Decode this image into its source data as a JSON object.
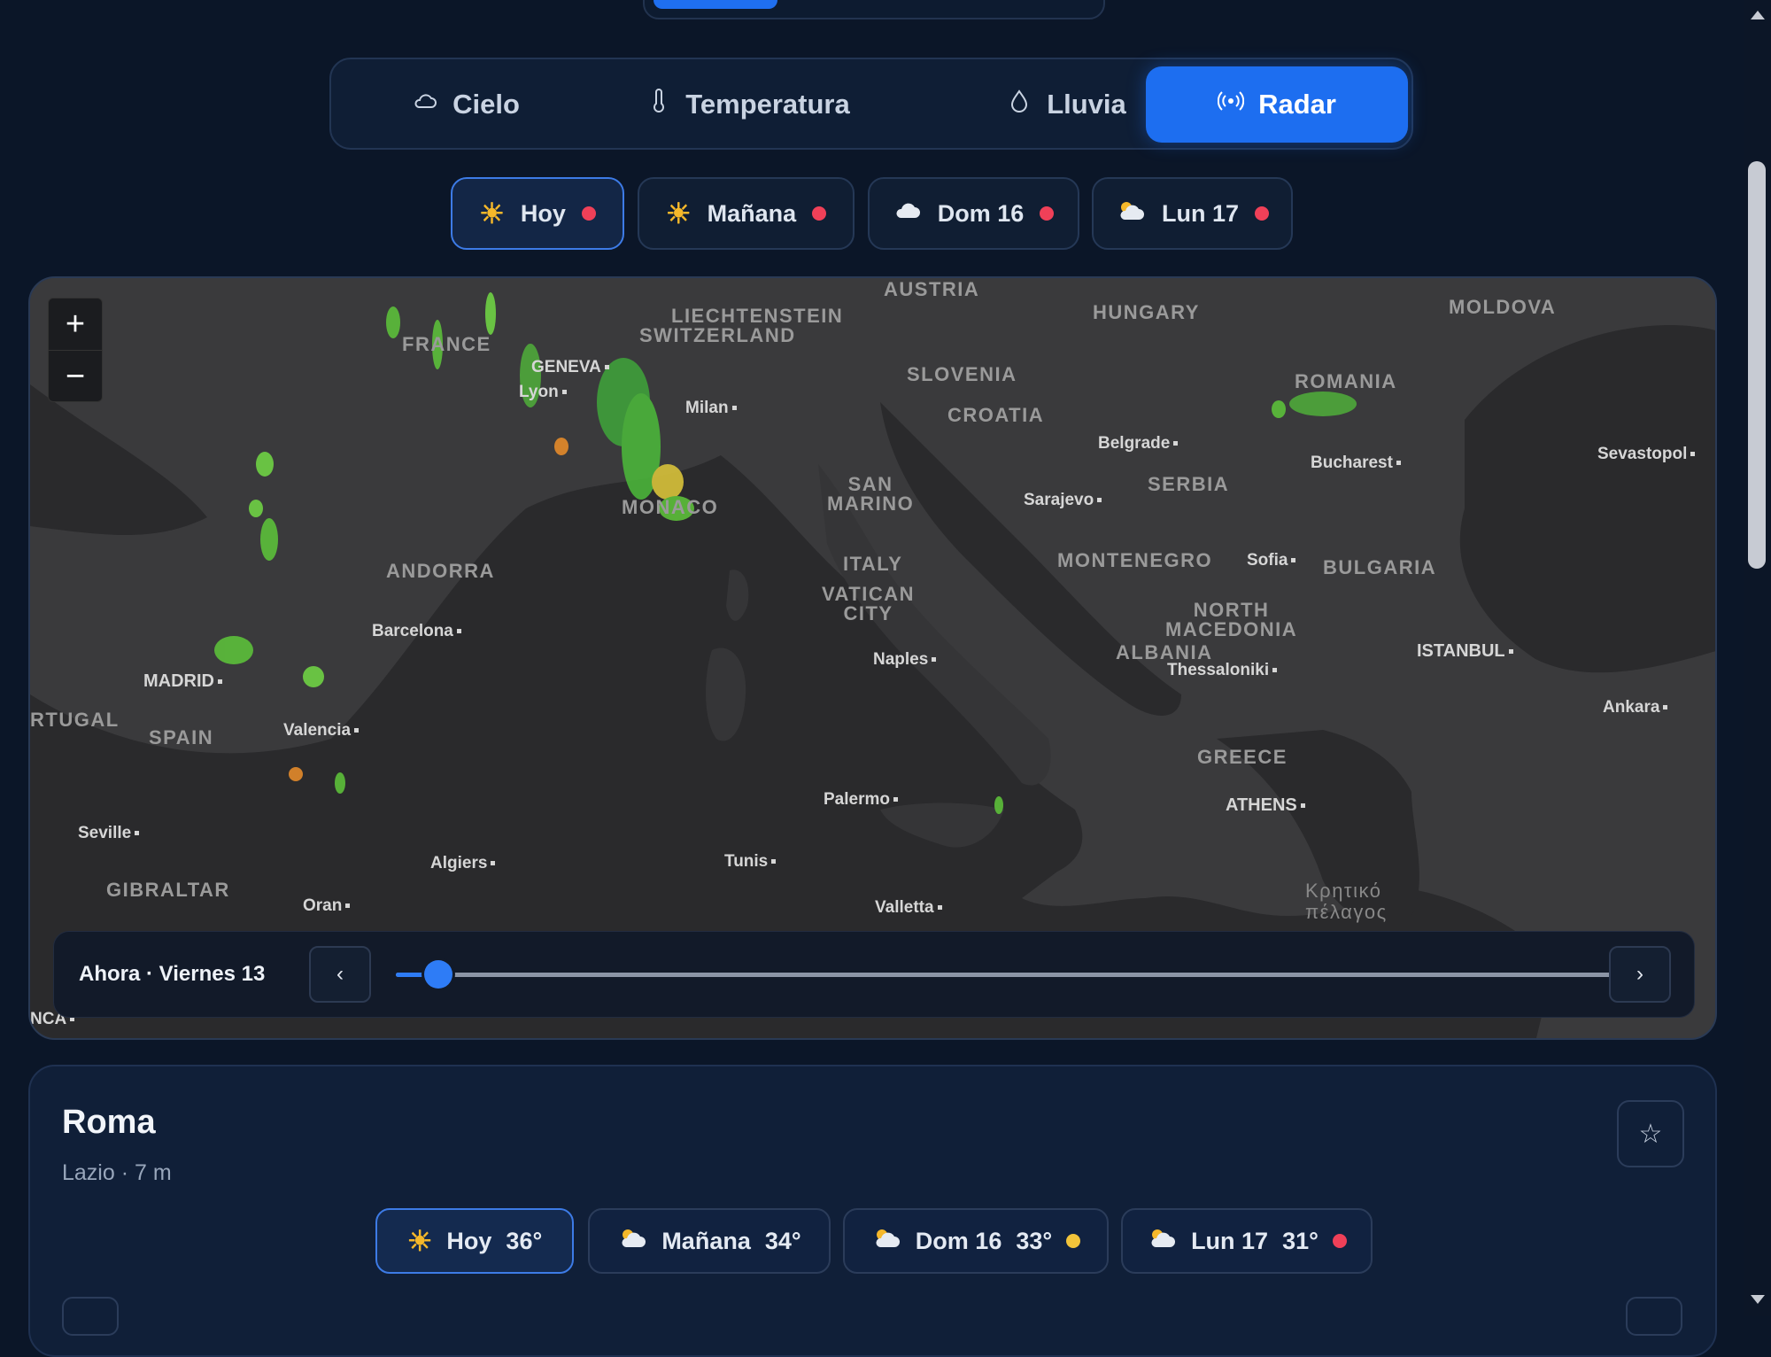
{
  "tabs": [
    {
      "label": "Cielo",
      "icon": "cloud-icon",
      "active": false
    },
    {
      "label": "Temperatura",
      "icon": "thermometer-icon",
      "active": false
    },
    {
      "label": "Lluvia",
      "icon": "drop-icon",
      "active": false
    },
    {
      "label": "Radar",
      "icon": "radar-icon",
      "active": true
    }
  ],
  "days": [
    {
      "label": "Hoy",
      "icon": "sun-icon",
      "alert": "red",
      "active": true
    },
    {
      "label": "Mañana",
      "icon": "sun-icon",
      "alert": "red",
      "active": false
    },
    {
      "label": "Dom 16",
      "icon": "cloud-icon",
      "alert": "red",
      "active": false
    },
    {
      "label": "Lun 17",
      "icon": "sun-cloud-icon",
      "alert": "red",
      "active": false
    }
  ],
  "map": {
    "zoom_in": "+",
    "zoom_out": "−",
    "labels": {
      "austria": "AUSTRIA",
      "liechtenstein": "LIECHTENSTEIN",
      "switzerland": "SWITZERLAND",
      "hungary": "HUNGARY",
      "moldova": "MOLDOVA",
      "france": "FRANCE",
      "geneva": "GENEVA",
      "lyon": "Lyon",
      "milan": "Milan",
      "slovenia": "SLOVENIA",
      "croatia": "CROATIA",
      "romania": "ROMANIA",
      "belgrade": "Belgrade",
      "bucharest": "Bucharest",
      "sevastopol": "Sevastopol",
      "serbia": "SERBIA",
      "sarajevo": "Sarajevo",
      "san_marino": "SAN\nMARINO",
      "monaco": "MONACO",
      "andorra": "ANDORRA",
      "italy": "ITALY",
      "montenegro": "MONTENEGRO",
      "sofia": "Sofia",
      "bulgaria": "BULGARIA",
      "vatican": "VATICAN\nCITY",
      "north_macedonia": "NORTH\nMACEDONIA",
      "barcelona": "Barcelona",
      "albania": "ALBANIA",
      "istanbul": "ISTANBUL",
      "naples": "Naples",
      "thessaloniki": "Thessaloniki",
      "madrid": "MADRID",
      "portugal": "RTUGAL",
      "spain": "SPAIN",
      "valencia": "Valencia",
      "ankara": "Ankara",
      "greece": "GREECE",
      "palermo": "Palermo",
      "athens": "ATHENS",
      "seville": "Seville",
      "algiers": "Algiers",
      "tunis": "Tunis",
      "gibraltar": "GIBRALTAR",
      "oran": "Oran",
      "valletta": "Valletta",
      "cretan_sea": "Κρητικό\nπέλαγος",
      "casablanca": "NCA"
    }
  },
  "timeline": {
    "label": "Ahora · Viernes 13",
    "prev": "‹",
    "next": "›",
    "progress": 0.034
  },
  "city": {
    "name": "Roma",
    "subtitle": "Lazio · 7 m",
    "star": "☆",
    "days": [
      {
        "label": "Hoy",
        "temp": "36°",
        "icon": "sun-icon",
        "alert": "",
        "active": true
      },
      {
        "label": "Mañana",
        "temp": "34°",
        "icon": "sun-cloud-icon",
        "alert": "",
        "active": false
      },
      {
        "label": "Dom 16",
        "temp": "33°",
        "icon": "sun-cloud-icon",
        "alert": "yellow",
        "active": false
      },
      {
        "label": "Lun 17",
        "temp": "31°",
        "icon": "sun-cloud-icon",
        "alert": "red",
        "active": false
      }
    ]
  },
  "colors": {
    "accent": "#1d6ef0",
    "alert_red": "#ef4058",
    "alert_yellow": "#f2c43a",
    "sun": "#f5b82a"
  }
}
